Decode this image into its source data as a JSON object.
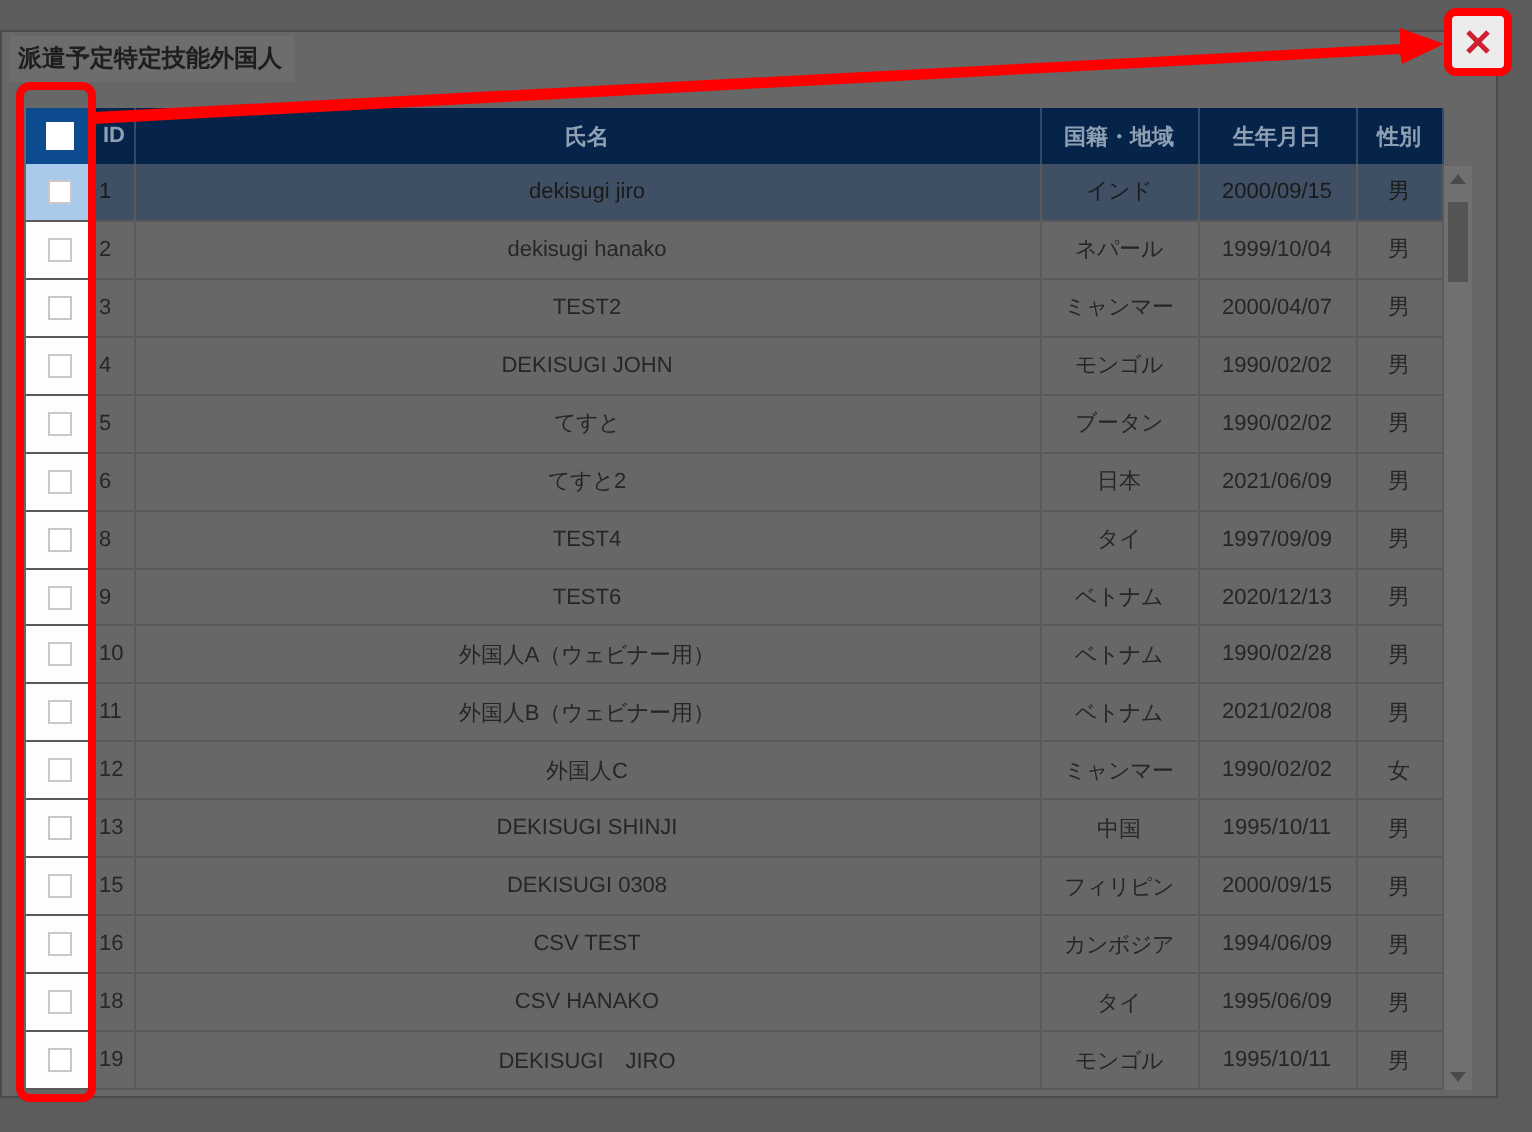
{
  "dialog": {
    "title": "派遣予定特定技能外国人"
  },
  "table": {
    "header_checkbox": {
      "checked": false
    },
    "columns": [
      "ID",
      "氏名",
      "国籍・地域",
      "生年月日",
      "性別"
    ],
    "rows": [
      {
        "checked": false,
        "selected": true,
        "id": "1",
        "name": "dekisugi jiro",
        "nationality": "インド",
        "birthdate": "2000/09/15",
        "gender": "男"
      },
      {
        "checked": false,
        "selected": false,
        "id": "2",
        "name": "dekisugi hanako",
        "nationality": "ネパール",
        "birthdate": "1999/10/04",
        "gender": "男"
      },
      {
        "checked": false,
        "selected": false,
        "id": "3",
        "name": "TEST2",
        "nationality": "ミャンマー",
        "birthdate": "2000/04/07",
        "gender": "男"
      },
      {
        "checked": false,
        "selected": false,
        "id": "4",
        "name": "DEKISUGI JOHN",
        "nationality": "モンゴル",
        "birthdate": "1990/02/02",
        "gender": "男"
      },
      {
        "checked": false,
        "selected": false,
        "id": "5",
        "name": "てすと",
        "nationality": "ブータン",
        "birthdate": "1990/02/02",
        "gender": "男"
      },
      {
        "checked": false,
        "selected": false,
        "id": "6",
        "name": "てすと2",
        "nationality": "日本",
        "birthdate": "2021/06/09",
        "gender": "男"
      },
      {
        "checked": false,
        "selected": false,
        "id": "8",
        "name": "TEST4",
        "nationality": "タイ",
        "birthdate": "1997/09/09",
        "gender": "男"
      },
      {
        "checked": false,
        "selected": false,
        "id": "9",
        "name": "TEST6",
        "nationality": "ベトナム",
        "birthdate": "2020/12/13",
        "gender": "男"
      },
      {
        "checked": false,
        "selected": false,
        "id": "10",
        "name": "外国人A（ウェビナー用）",
        "nationality": "ベトナム",
        "birthdate": "1990/02/28",
        "gender": "男"
      },
      {
        "checked": false,
        "selected": false,
        "id": "11",
        "name": "外国人B（ウェビナー用）",
        "nationality": "ベトナム",
        "birthdate": "2021/02/08",
        "gender": "男"
      },
      {
        "checked": false,
        "selected": false,
        "id": "12",
        "name": "外国人C",
        "nationality": "ミャンマー",
        "birthdate": "1990/02/02",
        "gender": "女"
      },
      {
        "checked": false,
        "selected": false,
        "id": "13",
        "name": "DEKISUGI SHINJI",
        "nationality": "中国",
        "birthdate": "1995/10/11",
        "gender": "男"
      },
      {
        "checked": false,
        "selected": false,
        "id": "15",
        "name": "DEKISUGI 0308",
        "nationality": "フィリピン",
        "birthdate": "2000/09/15",
        "gender": "男"
      },
      {
        "checked": false,
        "selected": false,
        "id": "16",
        "name": "CSV TEST",
        "nationality": "カンボジア",
        "birthdate": "1994/06/09",
        "gender": "男"
      },
      {
        "checked": false,
        "selected": false,
        "id": "18",
        "name": "CSV HANAKO",
        "nationality": "タイ",
        "birthdate": "1995/06/09",
        "gender": "男"
      },
      {
        "checked": false,
        "selected": false,
        "id": "19",
        "name": "DEKISUGI　JIRO",
        "nationality": "モンゴル",
        "birthdate": "1995/10/11",
        "gender": "男"
      }
    ]
  }
}
